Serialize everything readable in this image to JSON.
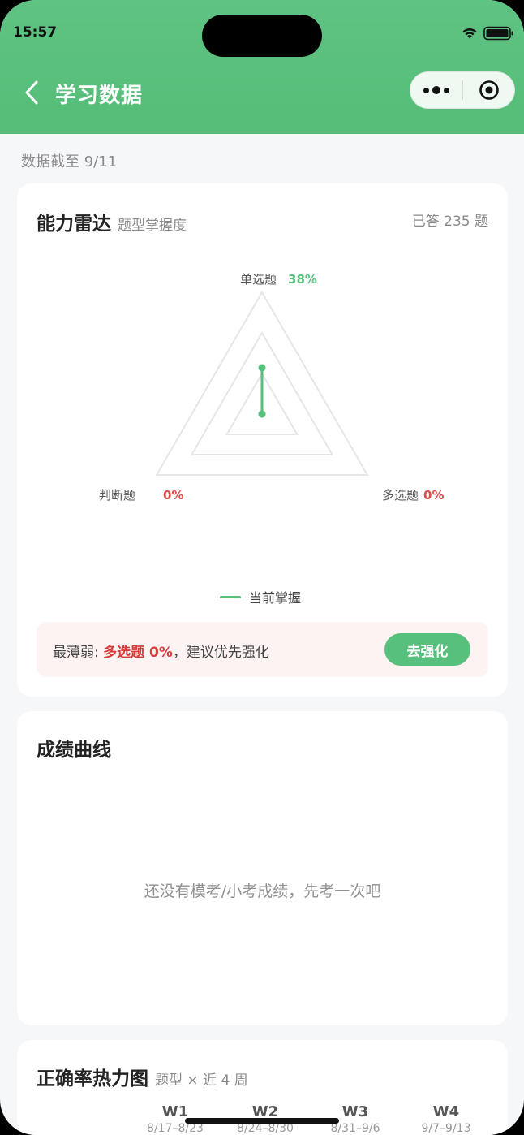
{
  "status": {
    "time": "15:57"
  },
  "nav": {
    "title": "学习数据",
    "back_icon": "chevron-left-icon",
    "more_icon": "more-dots-icon",
    "close_icon": "target-icon"
  },
  "data_date": "数据截至 9/11",
  "radar_card": {
    "title": "能力雷达",
    "subtitle": "题型掌握度",
    "answered": "已答 235 题",
    "axes": [
      {
        "label": "单选题",
        "pct": "38%"
      },
      {
        "label": "多选题",
        "pct": "0%"
      },
      {
        "label": "判断题",
        "pct": "0%"
      }
    ],
    "legend": "当前掌握",
    "weak_prefix": "最薄弱: ",
    "weak_item": "多选题 0%",
    "weak_suffix": "，建议优先强化",
    "strengthen_button": "去强化"
  },
  "chart_data": {
    "type": "radar",
    "categories": [
      "单选题",
      "多选题",
      "判断题"
    ],
    "series": [
      {
        "name": "当前掌握",
        "values": [
          38,
          0,
          0
        ]
      }
    ],
    "ylim": [
      0,
      100
    ],
    "grid_levels": 3,
    "legend_position": "bottom",
    "colors": {
      "series": "#56c07c",
      "grid": "#e6e6e6"
    }
  },
  "score_card": {
    "title": "成绩曲线",
    "empty_text": "还没有模考/小考成绩，先考一次吧"
  },
  "heatmap_card": {
    "title": "正确率热力图",
    "subtitle": "题型 × 近 4 周",
    "weeks": [
      {
        "name": "W1",
        "range": "8/17–8/23"
      },
      {
        "name": "W2",
        "range": "8/24–8/30"
      },
      {
        "name": "W3",
        "range": "8/31–9/6"
      },
      {
        "name": "W4",
        "range": "9/7–9/13"
      }
    ]
  },
  "colors": {
    "brand": "#56c07c",
    "danger": "#e04b4b",
    "background": "#f6f7f9"
  }
}
